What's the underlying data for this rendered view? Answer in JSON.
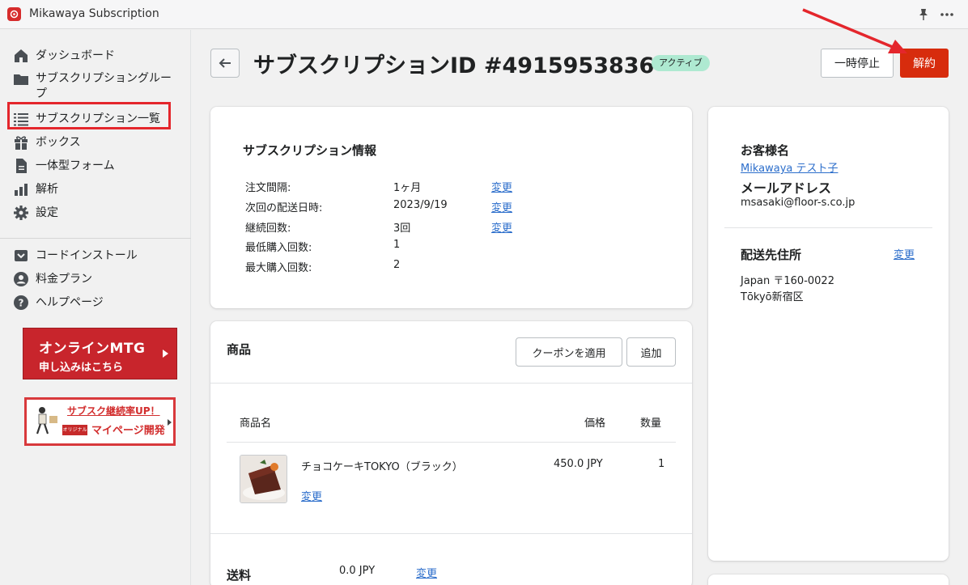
{
  "app": {
    "title": "Mikawaya Subscription"
  },
  "sidebar": {
    "items": [
      {
        "label": "ダッシュボード",
        "icon": "home-icon"
      },
      {
        "label": "サブスクリプショングループ",
        "icon": "folder-icon"
      },
      {
        "label": "サブスクリプション一覧",
        "icon": "list-icon"
      },
      {
        "label": "ボックス",
        "icon": "gift-icon"
      },
      {
        "label": "一体型フォーム",
        "icon": "document-icon"
      },
      {
        "label": "解析",
        "icon": "bar-chart-icon"
      },
      {
        "label": "設定",
        "icon": "gear-icon"
      }
    ],
    "secondary": [
      {
        "label": "コードインストール",
        "icon": "code-install-icon"
      },
      {
        "label": "料金プラン",
        "icon": "user-circle-icon"
      },
      {
        "label": "ヘルプページ",
        "icon": "help-icon"
      }
    ],
    "mtg_banner": {
      "line1": "オンラインMTG",
      "line2": "申し込みはこちら"
    },
    "up_banner": {
      "line1": "サブスク継続率UP！",
      "tag": "オリジナル",
      "line2": "マイページ開発"
    }
  },
  "header": {
    "title": "サブスクリプションID #4915953836",
    "status": "アクティブ",
    "pause_label": "一時停止",
    "cancel_label": "解約"
  },
  "info": {
    "title": "サブスクリプション情報",
    "rows": [
      {
        "label": "注文間隔:",
        "value": "1ヶ月",
        "action": "変更"
      },
      {
        "label": "次回の配送日時:",
        "value": "2023/9/19",
        "action": "変更"
      },
      {
        "label": "継続回数:",
        "value": "3回",
        "action": "変更"
      },
      {
        "label": "最低購入回数:",
        "value": "1"
      },
      {
        "label": "最大購入回数:",
        "value": "2"
      }
    ]
  },
  "products": {
    "title": "商品",
    "coupon_label": "クーポンを適用",
    "add_label": "追加",
    "columns": {
      "name": "商品名",
      "price": "価格",
      "qty": "数量"
    },
    "items": [
      {
        "name": "チョコケーキTOKYO（ブラック）",
        "price": "450.0 JPY",
        "qty": "1",
        "action": "変更"
      }
    ],
    "shipping": {
      "label": "送料",
      "value": "0.0 JPY",
      "action": "変更"
    }
  },
  "customer": {
    "name_title": "お客様名",
    "name": "Mikawaya テスト子",
    "email_title": "メールアドレス",
    "email": "msasaki@floor-s.co.jp",
    "address_title": "配送先住所",
    "address_action": "変更",
    "address_line1": "Japan 〒160-0022",
    "address_line2": "Tōkyō新宿区"
  },
  "colors": {
    "accent_red": "#d72c0d",
    "link": "#2c6ecb",
    "badge_green": "#aee9d1",
    "highlight_red": "#e4262c"
  }
}
